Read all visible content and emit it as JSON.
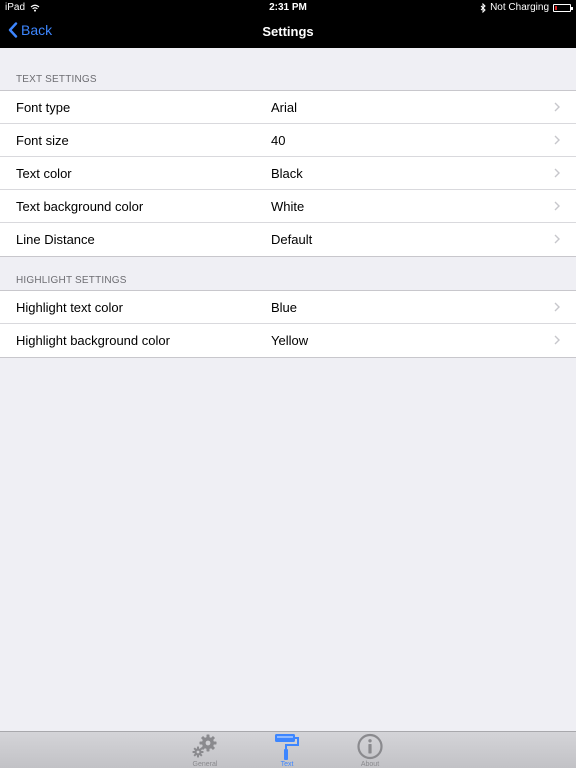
{
  "status_bar": {
    "device": "iPad",
    "time": "2:31 PM",
    "charging": "Not Charging",
    "icons": [
      "wifi-icon",
      "bluetooth-icon",
      "battery-icon"
    ]
  },
  "nav": {
    "back_label": "Back",
    "title": "Settings"
  },
  "sections": [
    {
      "header": "TEXT SETTINGS",
      "rows": [
        {
          "label": "Font type",
          "value": "Arial"
        },
        {
          "label": "Font size",
          "value": "40"
        },
        {
          "label": "Text color",
          "value": "Black"
        },
        {
          "label": "Text background color",
          "value": "White"
        },
        {
          "label": "Line Distance",
          "value": "Default"
        }
      ]
    },
    {
      "header": "HIGHLIGHT SETTINGS",
      "rows": [
        {
          "label": "Highlight text color",
          "value": "Blue"
        },
        {
          "label": "Highlight background color",
          "value": "Yellow"
        }
      ]
    }
  ],
  "tabs": [
    {
      "label": "General",
      "icon": "gears-icon",
      "active": false
    },
    {
      "label": "Text",
      "icon": "paint-roller-icon",
      "active": true
    },
    {
      "label": "About",
      "icon": "info-icon",
      "active": false
    }
  ],
  "colors": {
    "accent": "#3d86ff",
    "background": "#efeff4",
    "bar": "#000000"
  }
}
